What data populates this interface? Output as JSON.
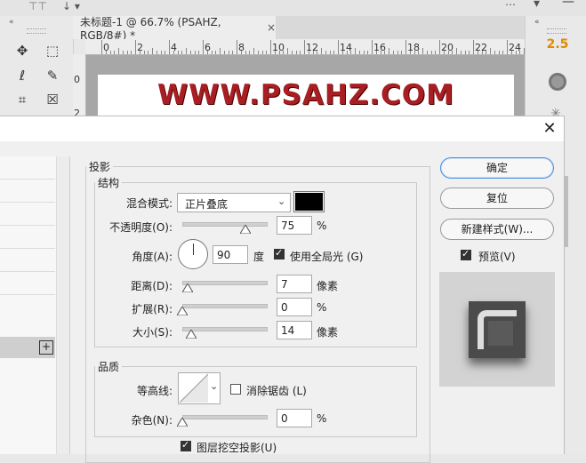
{
  "document": {
    "tab_title": "未标题-1 @ 66.7% (PSAHZ, RGB/8#) *",
    "close_symbol": "×",
    "canvas_text": "WWW.PSAHZ.COM",
    "ruler_h_labels": [
      "0",
      "2",
      "4",
      "6",
      "8",
      "10",
      "12",
      "14",
      "16",
      "18",
      "20",
      "22",
      "24"
    ],
    "ruler_v_labels": [
      "0",
      "2"
    ],
    "text_color": "#a81e22"
  },
  "right_panel": {
    "zoom_value": "2.5"
  },
  "dialog": {
    "close_symbol": "✕",
    "section_title": "投影",
    "structure": {
      "legend": "结构",
      "blend_mode_label": "混合模式:",
      "blend_mode_value": "正片叠底",
      "shadow_color": "#000000",
      "opacity_label": "不透明度(O):",
      "opacity_value": "75",
      "opacity_unit": "%",
      "angle_label": "角度(A):",
      "angle_value": "90",
      "angle_unit": "度",
      "global_light_label": "使用全局光 (G)",
      "global_light_checked": true,
      "distance_label": "距离(D):",
      "distance_value": "7",
      "distance_unit": "像素",
      "spread_label": "扩展(R):",
      "spread_value": "0",
      "spread_unit": "%",
      "size_label": "大小(S):",
      "size_value": "14",
      "size_unit": "像素"
    },
    "quality": {
      "legend": "品质",
      "contour_label": "等高线:",
      "anti_alias_label": "消除锯齿 (L)",
      "anti_alias_checked": false,
      "noise_label": "杂色(N):",
      "noise_value": "0",
      "noise_unit": "%"
    },
    "layer_knockout_label": "图层挖空投影(U)",
    "layer_knockout_checked": true,
    "buttons": {
      "ok": "确定",
      "reset": "复位",
      "new_style": "新建样式(W)...",
      "preview_label": "预览(V)",
      "preview_checked": true
    },
    "left_list": {
      "add_symbol": "+"
    }
  }
}
